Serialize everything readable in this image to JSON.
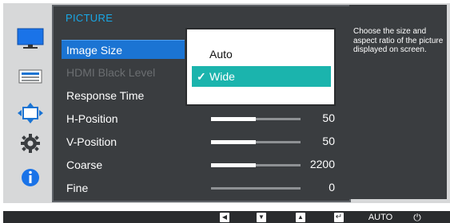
{
  "menu": {
    "title": "PICTURE",
    "items": [
      {
        "label": "Image Size",
        "state": "selected"
      },
      {
        "label": "HDMI Black Level",
        "state": "disabled"
      },
      {
        "label": "Response Time",
        "state": "normal"
      },
      {
        "label": "H-Position",
        "state": "normal"
      },
      {
        "label": "V-Position",
        "state": "normal"
      },
      {
        "label": "Coarse",
        "state": "normal"
      },
      {
        "label": "Fine",
        "state": "normal"
      }
    ],
    "sliders": [
      {
        "name": "H-Position",
        "value": "50",
        "fraction": 0.5
      },
      {
        "name": "V-Position",
        "value": "50",
        "fraction": 0.5
      },
      {
        "name": "Coarse",
        "value": "2200",
        "fraction": 0.5
      },
      {
        "name": "Fine",
        "value": "0",
        "fraction": 0
      }
    ]
  },
  "popup": {
    "options": [
      {
        "label": "Auto",
        "selected": false
      },
      {
        "label": "Wide",
        "selected": true
      }
    ],
    "check_glyph": "✓"
  },
  "help": {
    "text": "Choose the size and aspect ratio of the picture displayed on screen."
  },
  "side_icons": [
    "picture-icon",
    "onscreen-display-icon",
    "setup-icon",
    "system-gear-icon",
    "information-icon"
  ],
  "buttons": {
    "left": "◀",
    "down": "▼",
    "up": "▲",
    "enter": "↵",
    "auto": "AUTO",
    "power": "⏻"
  },
  "colors": {
    "panel": "#3a3d40",
    "accent_blue": "#1b74d3",
    "popup_highlight": "#1bb4ad",
    "title_blue": "#19a7e5"
  }
}
